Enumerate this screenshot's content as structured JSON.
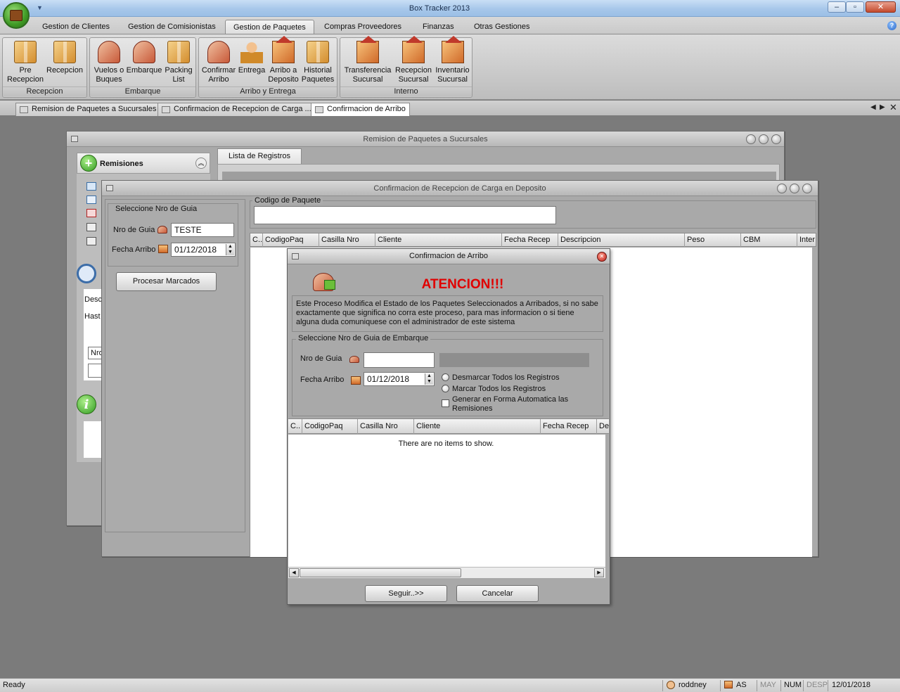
{
  "app": {
    "title": "Box Tracker 2013"
  },
  "ribbon": {
    "tabs": [
      "Gestion de Clientes",
      "Gestion de Comisionistas",
      "Gestion de Paquetes",
      "Compras  Proveedores",
      "Finanzas",
      "Otras Gestiones"
    ],
    "active_tab": "Gestion de Paquetes",
    "groups": [
      {
        "label": "Recepcion",
        "buttons": [
          {
            "line1": "Pre",
            "line2": "Recepcion",
            "icon": "box-icon"
          },
          {
            "line1": "Recepcion",
            "line2": "",
            "icon": "box-icon"
          }
        ]
      },
      {
        "label": "Embarque",
        "buttons": [
          {
            "line1": "Vuelos o",
            "line2": "Buques",
            "icon": "plane-icon"
          },
          {
            "line1": "Embarque",
            "line2": "",
            "icon": "plane-icon"
          },
          {
            "line1": "Packing",
            "line2": "List",
            "icon": "box-icon"
          }
        ]
      },
      {
        "label": "Arribo y Entrega",
        "buttons": [
          {
            "line1": "Confirmar",
            "line2": "Arribo",
            "icon": "plane-house-icon"
          },
          {
            "line1": "Entrega",
            "line2": "",
            "icon": "person-box-icon"
          },
          {
            "line1": "Arribo a",
            "line2": "Deposito",
            "icon": "house-box-icon"
          },
          {
            "line1": "Historial",
            "line2": "Paquetes",
            "icon": "box-icon"
          }
        ]
      },
      {
        "label": "Interno",
        "buttons": [
          {
            "line1": "Transferencia",
            "line2": "Sucursal",
            "icon": "house-transfer-icon"
          },
          {
            "line1": "Recepcion",
            "line2": "Sucursal",
            "icon": "house-icon"
          },
          {
            "line1": "Inventario",
            "line2": "Sucursal",
            "icon": "house-icon"
          }
        ]
      }
    ]
  },
  "doc_tabs": [
    {
      "label": "Remision de Paquetes a Sucursales",
      "active": false
    },
    {
      "label": "Confirmacion de Recepcion de Carga ...",
      "active": false
    },
    {
      "label": "Confirmacion de Arribo",
      "active": true
    }
  ],
  "window_remision": {
    "title": "Remision de Paquetes a Sucursales",
    "panel_label": "Remisiones",
    "tab_label": "Lista de Registros",
    "search_from_label": "Desc",
    "search_to_label": "Hast",
    "nro_field_value": "Nro"
  },
  "window_confirmacion_carga": {
    "title": "Confirmacion de Recepcion de Carga en Deposito",
    "fieldset_label": "Seleccione Nro de Guia",
    "nro_guia_label": "Nro de Guia",
    "nro_guia_value": "TESTE",
    "fecha_arribo_label": "Fecha Arribo",
    "fecha_arribo_value": "01/12/2018",
    "process_button": "Procesar Marcados",
    "codigo_paquete_label": "Codigo de Paquete",
    "columns": [
      "C..",
      "CodigoPaq",
      "Casilla Nro",
      "Cliente",
      "Fecha Recep",
      "Descripcion",
      "Peso",
      "CBM",
      "Inter"
    ]
  },
  "dialog": {
    "title": "Confirmacion de Arribo",
    "heading": "ATENCION!!!",
    "message": "Este Proceso Modifica el Estado de los Paquetes Seleccionados a Arribados, si no sabe exactamente que significa no corra este proceso, para mas informacion o si tiene alguna duda comuniquese con el administrador de este sistema",
    "fieldset_label": "Seleccione Nro de Guia de Embarque",
    "nro_guia_label": "Nro de Guia",
    "nro_guia_value": "",
    "fecha_arribo_label": "Fecha Arribo",
    "fecha_arribo_value": "01/12/2018",
    "options": {
      "desmarcar": "Desmarcar Todos los Registros",
      "marcar": "Marcar Todos los Registros",
      "generar": "Generar en Forma Automatica las Remisiones"
    },
    "columns": [
      "C..",
      "CodigoPaq",
      "Casilla Nro",
      "Cliente",
      "Fecha Recep",
      "De"
    ],
    "empty_text": "There are no items to show.",
    "buttons": {
      "seguir": "Seguir..>>",
      "cancelar": "Cancelar"
    }
  },
  "status": {
    "ready": "Ready",
    "user": "roddney",
    "branch": "AS",
    "may": "MAY",
    "num": "NUM",
    "desp": "DESP",
    "date": "12/01/2018"
  }
}
